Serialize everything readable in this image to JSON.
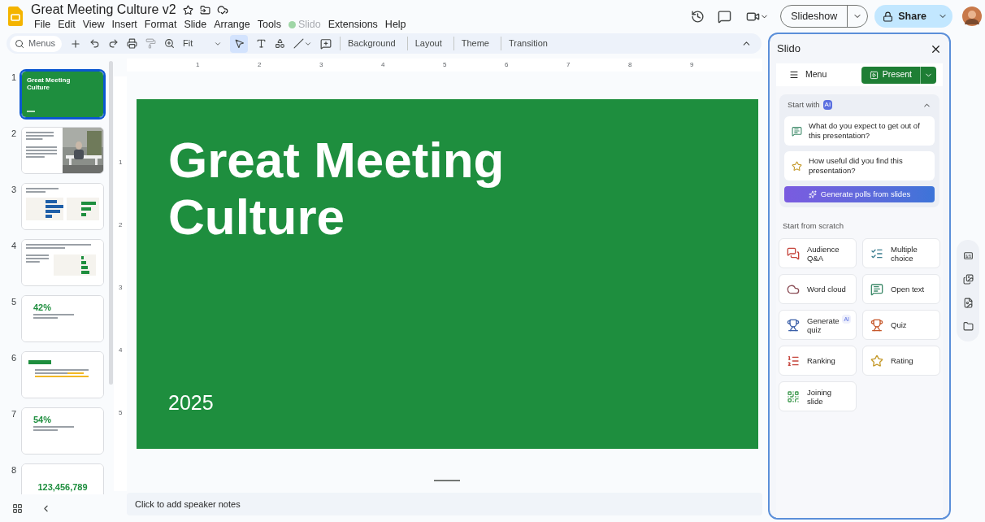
{
  "app": {
    "title": "Great Meeting Culture v2"
  },
  "menus": [
    {
      "label": "File",
      "disabled": false
    },
    {
      "label": "Edit",
      "disabled": false
    },
    {
      "label": "View",
      "disabled": false
    },
    {
      "label": "Insert",
      "disabled": false
    },
    {
      "label": "Format",
      "disabled": false
    },
    {
      "label": "Slide",
      "disabled": false
    },
    {
      "label": "Arrange",
      "disabled": false
    },
    {
      "label": "Tools",
      "disabled": false
    },
    {
      "label": "Slido",
      "disabled": true
    },
    {
      "label": "Extensions",
      "disabled": false
    },
    {
      "label": "Help",
      "disabled": false
    }
  ],
  "header": {
    "slideshow": "Slideshow",
    "share": "Share"
  },
  "toolbar": {
    "search_placeholder": "Menus",
    "zoom": "Fit",
    "buttons": [
      "Background",
      "Layout",
      "Theme",
      "Transition"
    ]
  },
  "ruler": {
    "horizontal": [
      "1",
      "2",
      "3",
      "4",
      "5",
      "6",
      "7",
      "8",
      "9"
    ],
    "vertical": [
      "1",
      "2",
      "3",
      "4",
      "5"
    ]
  },
  "slides": [
    {
      "number": "1",
      "kind": "title",
      "selected": true,
      "text": "Great Meeting Culture"
    },
    {
      "number": "2",
      "selected": false
    },
    {
      "number": "3",
      "kind": "bars",
      "selected": false
    },
    {
      "number": "4",
      "kind": "study",
      "selected": false
    },
    {
      "number": "5",
      "kind": "stat",
      "selected": false,
      "text": "42%"
    },
    {
      "number": "6",
      "kind": "callout",
      "selected": false
    },
    {
      "number": "7",
      "kind": "stat",
      "selected": false,
      "text": "54%"
    },
    {
      "number": "8",
      "kind": "number",
      "selected": false,
      "text": "123,456,789"
    }
  ],
  "slide": {
    "title": "Great Meeting Culture",
    "subtitle": "2025"
  },
  "notes": {
    "placeholder": "Click to add speaker notes"
  },
  "slido": {
    "title": "Slido",
    "menu": "Menu",
    "present": "Present",
    "start_with": "Start with",
    "ai_badge": "AI",
    "suggestions": [
      {
        "kind": "open",
        "text": "What do you expect to get out of this presentation?"
      },
      {
        "kind": "rating",
        "text": "How useful did you find this presentation?"
      }
    ],
    "generate": "Generate polls from slides",
    "scratch_title": "Start from scratch",
    "items": [
      {
        "kind": "qa",
        "label": "Audience Q&A"
      },
      {
        "kind": "multiple",
        "label": "Multiple choice"
      },
      {
        "kind": "cloud",
        "label": "Word cloud"
      },
      {
        "kind": "open",
        "label": "Open text"
      },
      {
        "kind": "genquiz",
        "label": "Generate quiz",
        "badge": "AI"
      },
      {
        "kind": "quiz",
        "label": "Quiz"
      },
      {
        "kind": "ranking",
        "label": "Ranking"
      },
      {
        "kind": "rating",
        "label": "Rating"
      },
      {
        "kind": "joining",
        "label": "Joining slide"
      }
    ]
  }
}
